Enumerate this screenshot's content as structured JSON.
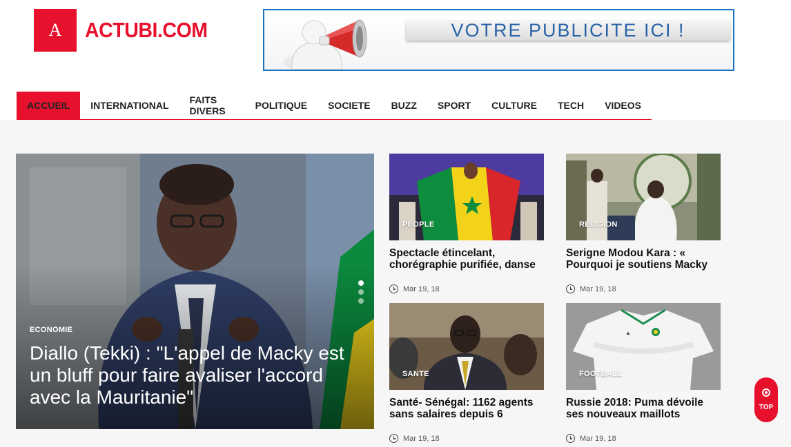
{
  "site": {
    "logo_letter": "A",
    "logo_text": "ACTUBI.COM",
    "brand_color": "#e8112d"
  },
  "ad": {
    "text": "VOTRE PUBLICITE ICI !"
  },
  "nav": {
    "items": [
      {
        "label": "ACCUEIL",
        "active": true
      },
      {
        "label": "INTERNATIONAL"
      },
      {
        "label": "FAITS DIVERS"
      },
      {
        "label": "POLITIQUE"
      },
      {
        "label": "SOCIETE"
      },
      {
        "label": "BUZZ"
      },
      {
        "label": "SPORT"
      },
      {
        "label": "CULTURE"
      },
      {
        "label": "TECH"
      },
      {
        "label": "VIDEOS"
      }
    ]
  },
  "featured": {
    "category": "ECONOMIE",
    "title": "Diallo (Tekki) : \"L'appel de Macky est un bluff pour faire avaliser l'accord avec la Mauritanie\""
  },
  "cards": [
    {
      "category": "PEOPLE",
      "title": "Spectacle étincelant, chorégraphie purifiée, danse",
      "date": "Mar 19, 18"
    },
    {
      "category": "RELIGION",
      "title": "Serigne Modou Kara : « Pourquoi je soutiens Macky",
      "date": "Mar 19, 18"
    },
    {
      "category": "SANTE",
      "title": "Santé- Sénégal: 1162 agents sans salaires depuis 6",
      "date": "Mar 19, 18"
    },
    {
      "category": "FOOTBALL",
      "title": "Russie 2018: Puma dévoile ses nouveaux maillots",
      "date": "Mar 19, 18"
    }
  ],
  "top_button": {
    "label": "TOP"
  }
}
